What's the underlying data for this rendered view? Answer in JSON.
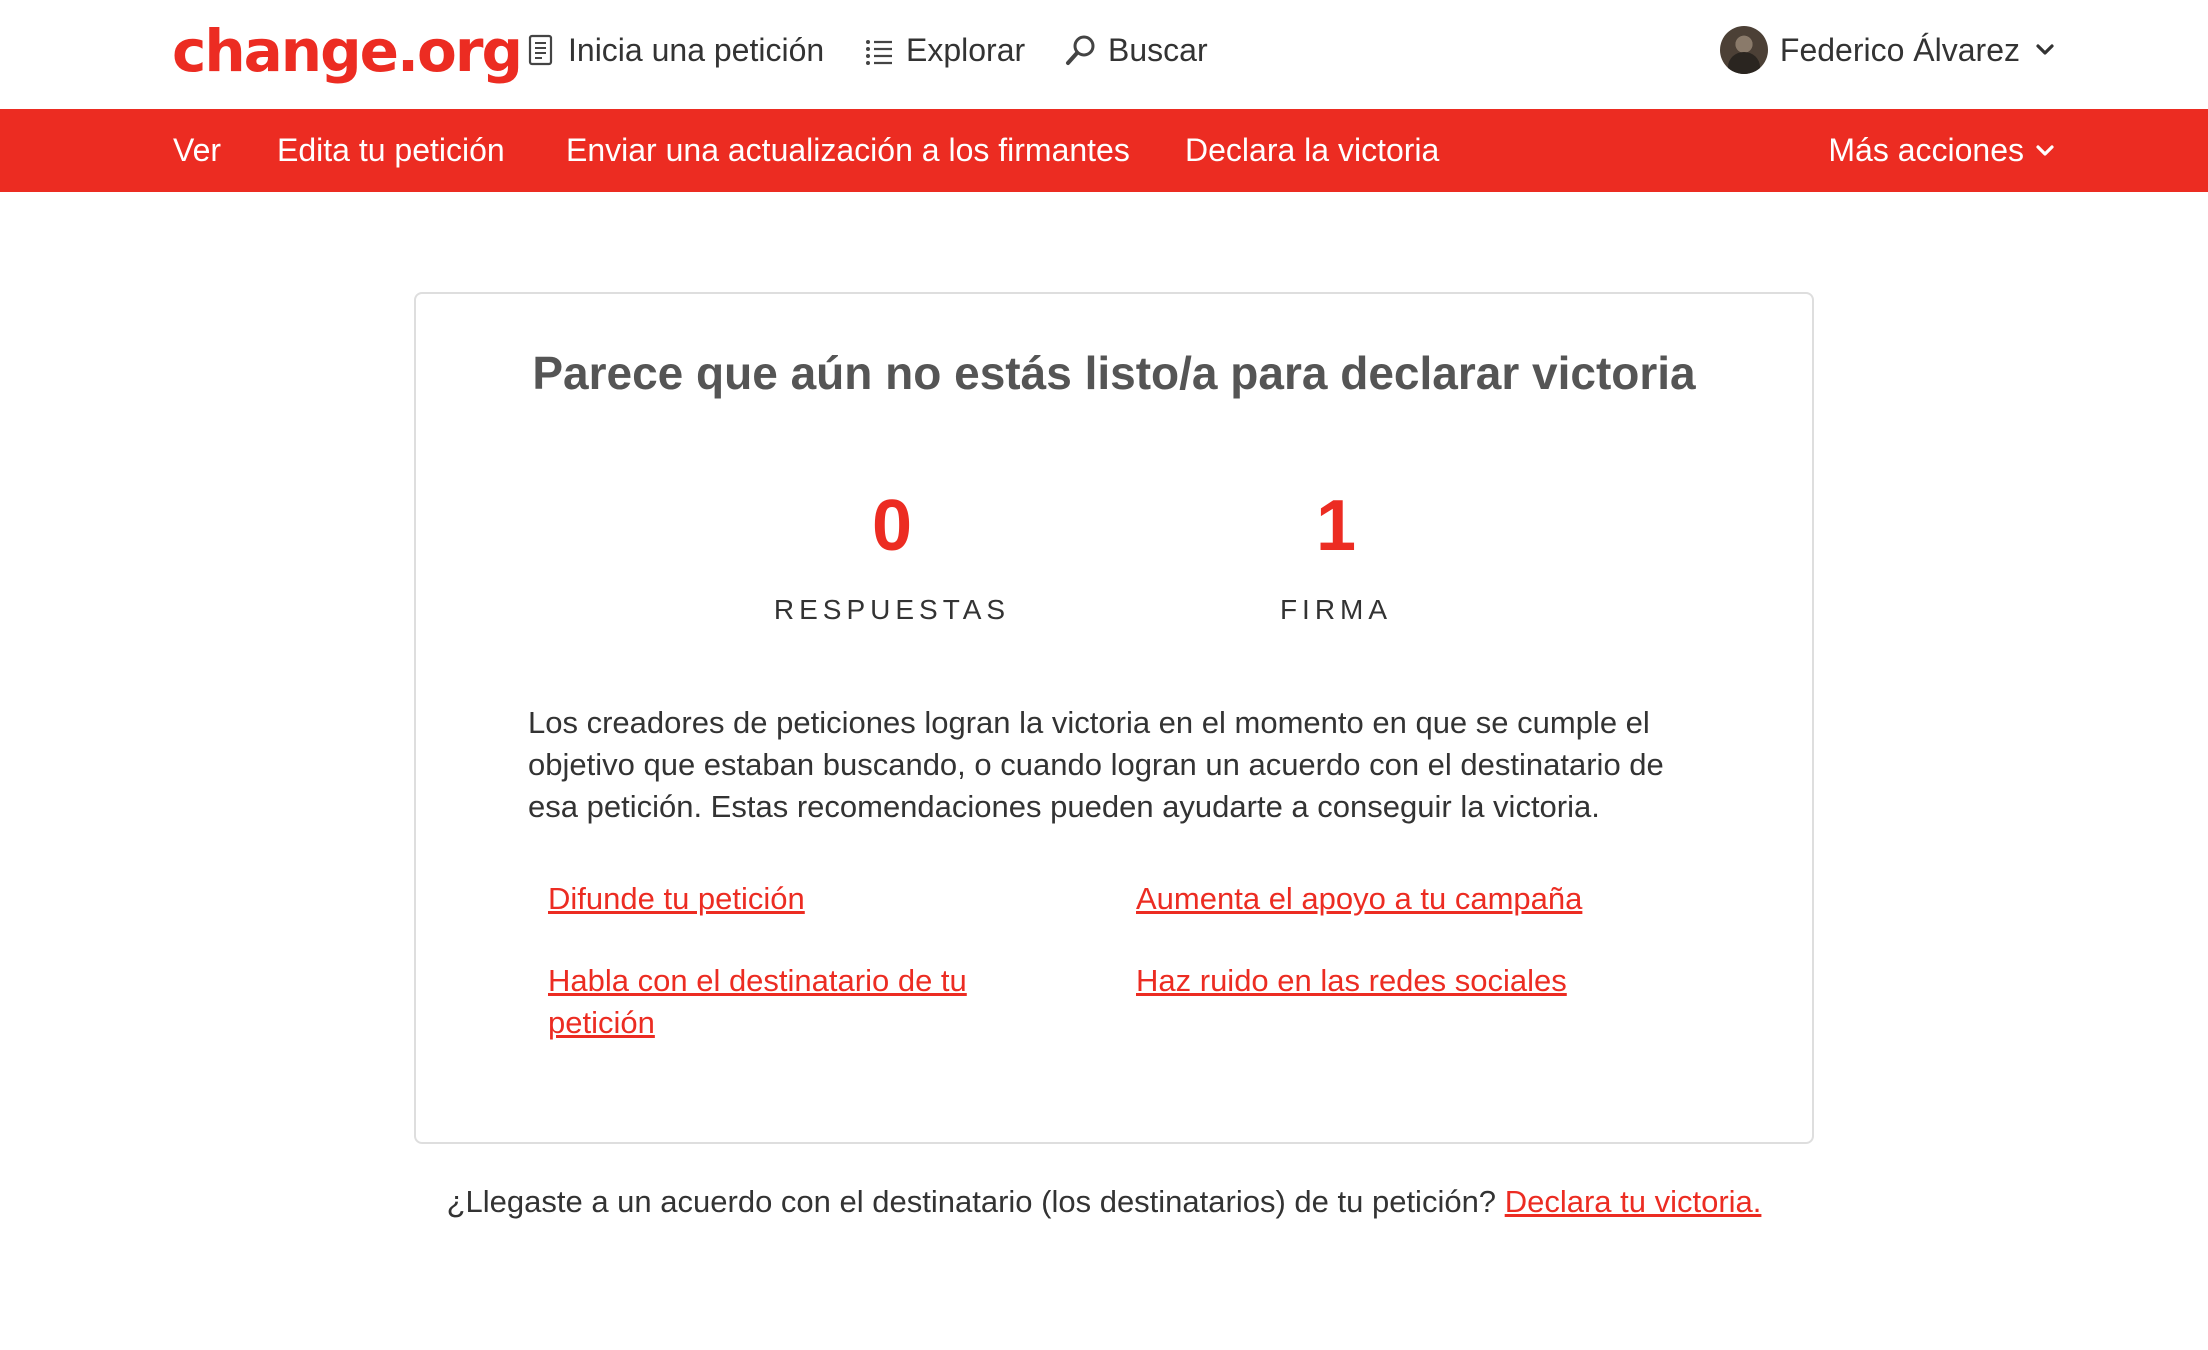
{
  "header": {
    "logo": "change.org",
    "nav": [
      {
        "label": "Inicia una petición",
        "icon": "document-icon"
      },
      {
        "label": "Explorar",
        "icon": "list-icon"
      },
      {
        "label": "Buscar",
        "icon": "search-icon"
      }
    ],
    "user": {
      "name": "Federico Álvarez",
      "icon": "chevron-down-icon"
    }
  },
  "action_bar": {
    "items": [
      "Ver",
      "Edita tu petición",
      "Enviar una actualización a los firmantes",
      "Declara la victoria"
    ],
    "more_label": "Más acciones"
  },
  "card": {
    "title": "Parece que aún no estás listo/a para declarar victoria",
    "stats": [
      {
        "value": "0",
        "label": "RESPUESTAS"
      },
      {
        "value": "1",
        "label": "FIRMA"
      }
    ],
    "description": "Los creadores de peticiones logran la victoria en el momento en que se cumple el objetivo que estaban buscando, o cuando logran un acuerdo con el destinatario de esa petición. Estas recomendaciones pueden ayudarte a conseguir la victoria.",
    "links": [
      "Difunde tu petición",
      "Aumenta el apoyo a tu campaña",
      "Habla con el destinatario de tu petición",
      "Haz ruido en las redes sociales"
    ]
  },
  "footer": {
    "question": "¿Llegaste a un acuerdo con el destinatario (los destinatarios) de tu petición?",
    "link": "Declara tu victoria."
  },
  "colors": {
    "brand": "#ec2c22",
    "text": "#333333",
    "title": "#555555",
    "border": "#dedede"
  }
}
